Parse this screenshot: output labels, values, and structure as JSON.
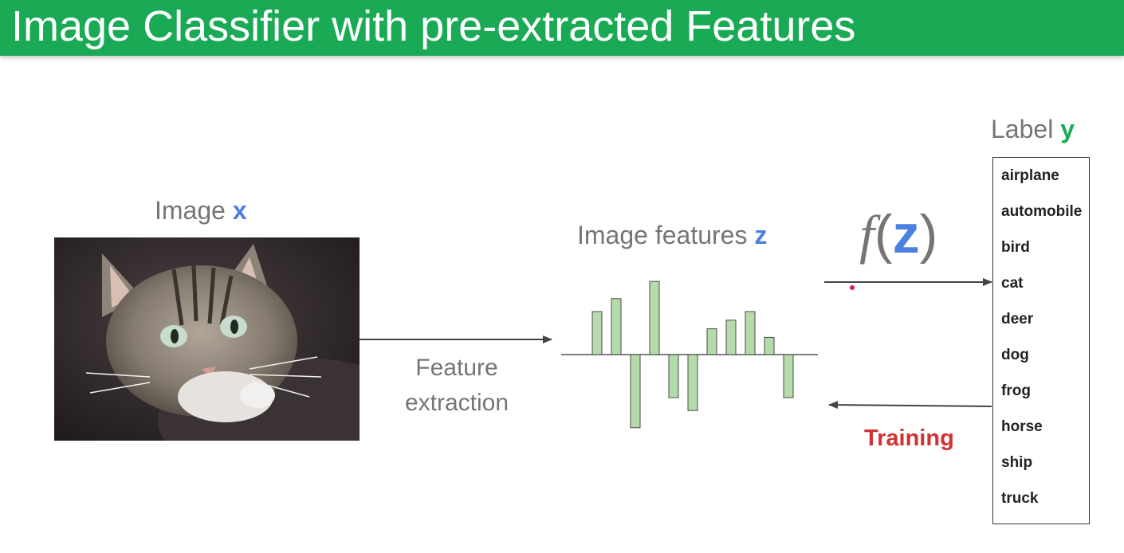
{
  "header": {
    "title": "Image Classifier with pre-extracted Features"
  },
  "image_section": {
    "prefix": "Image ",
    "variable": "x",
    "variable_color": "#4b7fe0"
  },
  "feature_extraction": {
    "line1": "Feature",
    "line2": "extraction"
  },
  "features_section": {
    "prefix": "Image features ",
    "variable": "z",
    "variable_color": "#4b7fe0"
  },
  "function": {
    "name": "f",
    "open": "(",
    "arg": "z",
    "close": ")"
  },
  "label_section": {
    "prefix": "Label ",
    "variable": "y",
    "variable_color": "#1aaa55"
  },
  "labels": [
    "airplane",
    "automobile",
    "bird",
    "cat",
    "deer",
    "dog",
    "frog",
    "horse",
    "ship",
    "truck"
  ],
  "training": {
    "text": "Training",
    "color": "#d03232"
  },
  "feature_bars": {
    "values": [
      1.0,
      1.3,
      -1.7,
      1.7,
      -1.0,
      -1.3,
      0.6,
      0.8,
      1.0,
      0.4,
      -1.0
    ],
    "ylim": [
      -2,
      2
    ],
    "color": "#b5dbab"
  }
}
